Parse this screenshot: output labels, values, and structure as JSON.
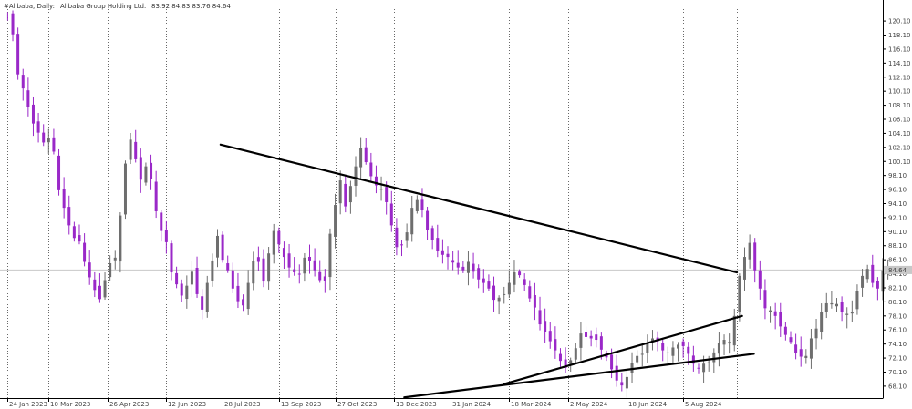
{
  "header": {
    "symbol": "#Alibaba, Daily:",
    "name": "Alibaba Group Holding Ltd.",
    "ohlc": "83.92 84.83 83.76 84.64"
  },
  "current_price_label": "84.64",
  "colors": {
    "up": "#6e6e6e",
    "down": "#9a28c8",
    "grid": "#444444",
    "trendline": "#000000",
    "price_line": "#c8c8c8",
    "price_box": "#c8c8c8"
  },
  "chart_data": {
    "type": "candlestick",
    "x_tick_labels": [
      "24 Jan 2023",
      "10 Mar 2023",
      "26 Apr 2023",
      "12 Jun 2023",
      "28 Jul 2023",
      "13 Sep 2023",
      "27 Oct 2023",
      "13 Dec 2023",
      "31 Jan 2024",
      "18 Mar 2024",
      "2 May 2024",
      "18 Jun 2024",
      "5 Aug 2024"
    ],
    "y_tick_labels": [
      "120.10",
      "118.10",
      "116.10",
      "114.10",
      "112.10",
      "110.10",
      "108.10",
      "106.10",
      "104.10",
      "102.10",
      "100.10",
      "98.10",
      "96.10",
      "94.10",
      "92.10",
      "90.10",
      "88.10",
      "86.10",
      "84.10",
      "82.10",
      "80.10",
      "78.10",
      "76.10",
      "74.10",
      "72.10",
      "70.10",
      "68.10"
    ],
    "y_ticks": [
      120.1,
      118.1,
      116.1,
      114.1,
      112.1,
      110.1,
      108.1,
      106.1,
      104.1,
      102.1,
      100.1,
      98.1,
      96.1,
      94.1,
      92.1,
      90.1,
      88.1,
      86.1,
      84.1,
      82.1,
      80.1,
      78.1,
      76.1,
      74.1,
      72.1,
      70.1,
      68.1
    ],
    "ylim": [
      66.4,
      121.8
    ],
    "xlim": [
      -1.5,
      171
    ],
    "vertical_grid_at": [
      0,
      8,
      19.5,
      31,
      42,
      53,
      64,
      75.5,
      86.5,
      98,
      109.5,
      121,
      132,
      142.5
    ],
    "current_price": 84.64,
    "closes": [
      120.9,
      118.2,
      112.5,
      110.5,
      107.8,
      105.5,
      104.2,
      102.8,
      103.5,
      101.5,
      96.0,
      93.5,
      91.0,
      89.2,
      88.7,
      85.8,
      83.6,
      81.8,
      80.5,
      83.2,
      85.6,
      86.4,
      92.4,
      99.8,
      103.2,
      100.4,
      97.5,
      99.4,
      97.6,
      93.0,
      90.2,
      88.6,
      84.3,
      82.6,
      81.0,
      82.4,
      84.4,
      81.2,
      79.0,
      82.8,
      86.0,
      89.5,
      86.1,
      84.6,
      82.0,
      80.2,
      79.6,
      82.8,
      85.9,
      85.8,
      83.0,
      87.0,
      90.2,
      88.3,
      86.5,
      85.0,
      84.3,
      84.0,
      86.4,
      86.0,
      84.6,
      83.2,
      83.1,
      89.8,
      93.9,
      97.4,
      93.7,
      96.6,
      99.4,
      102.0,
      100.0,
      98.0,
      96.7,
      96.2,
      94.3,
      91.0,
      87.9,
      88.2,
      90.0,
      93.5,
      94.6,
      93.2,
      90.4,
      88.9,
      87.3,
      86.8,
      86.5,
      85.7,
      85.0,
      84.6,
      85.8,
      84.4,
      83.3,
      82.8,
      82.0,
      80.4,
      80.7,
      81.2,
      82.8,
      84.3,
      83.9,
      82.5,
      80.6,
      79.3,
      76.9,
      75.8,
      74.5,
      73.2,
      71.7,
      70.7,
      71.8,
      73.5,
      75.6,
      75.1,
      74.9,
      74.7,
      73.3,
      72.2,
      70.5,
      68.9,
      68.2,
      69.4,
      71.4,
      72.4,
      72.7,
      74.2,
      74.9,
      74.5,
      73.2,
      72.9,
      73.6,
      74.0,
      73.8,
      72.7,
      71.3,
      70.7,
      71.3,
      71.5,
      72.9,
      74.2,
      74.7,
      74.4,
      78.1,
      83.8,
      86.5,
      88.5,
      84.6,
      82.0,
      79.2,
      78.9,
      78.1,
      76.6,
      75.4,
      74.4,
      72.8,
      72.3,
      72.4,
      74.9,
      76.3,
      78.7,
      79.9,
      79.9,
      79.8,
      78.6,
      78.4,
      78.6,
      81.6,
      83.8,
      84.8,
      82.8,
      82.0,
      84.6,
      84.6
    ],
    "trendlines": [
      {
        "x1": 41.6,
        "y1": 102.5,
        "x2": 142.5,
        "y2": 84.3
      },
      {
        "x1": 97.0,
        "y1": 68.4,
        "x2": 143.5,
        "y2": 78.1
      },
      {
        "x1": 77.5,
        "y1": 66.5,
        "x2": 145.8,
        "y2": 72.7
      }
    ]
  }
}
